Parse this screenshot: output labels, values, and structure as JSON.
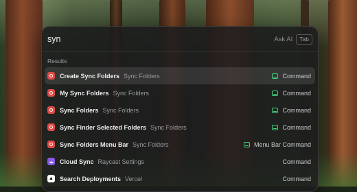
{
  "search": {
    "value": "syn",
    "ask_ai": "Ask AI",
    "tab_key": "Tab"
  },
  "section_title": "Results",
  "results": [
    {
      "title": "Create Sync Folders",
      "subtitle": "Sync Folders",
      "kind": "Command",
      "accessory": "menu-bar-icon",
      "icon": "sync-folders-icon",
      "selected": true
    },
    {
      "title": "My Sync Folders",
      "subtitle": "Sync Folders",
      "kind": "Command",
      "accessory": "menu-bar-icon",
      "icon": "sync-folders-icon"
    },
    {
      "title": "Sync Folders",
      "subtitle": "Sync Folders",
      "kind": "Command",
      "accessory": "menu-bar-icon",
      "icon": "sync-folders-icon"
    },
    {
      "title": "Sync Finder Selected Folders",
      "subtitle": "Sync Folders",
      "kind": "Command",
      "accessory": "menu-bar-icon",
      "icon": "sync-folders-icon"
    },
    {
      "title": "Sync Folders Menu Bar",
      "subtitle": "Sync Folders",
      "kind": "Menu Bar Command",
      "accessory": "menu-bar-icon",
      "icon": "sync-folders-icon"
    },
    {
      "title": "Cloud Sync",
      "subtitle": "Raycast Settings",
      "kind": "Command",
      "icon": "cloud-sync-icon"
    },
    {
      "title": "Search Deployments",
      "subtitle": "Vercel",
      "kind": "Command",
      "icon": "vercel-icon"
    }
  ],
  "colors": {
    "accent_green": "#3fd27a",
    "sync_red": "#e04b45",
    "cloud_purple": "#8a5ae6"
  }
}
